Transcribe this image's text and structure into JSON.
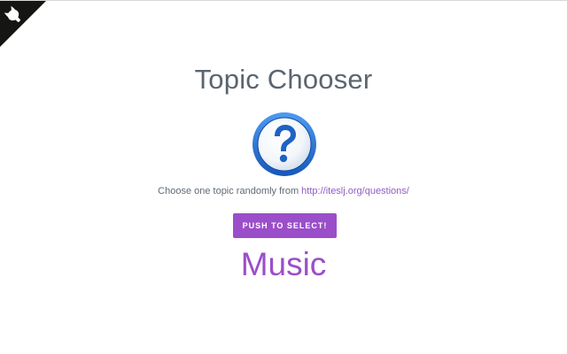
{
  "header": {
    "title": "Topic Chooser"
  },
  "icons": {
    "corner": "github-octocat-icon",
    "center": "question-mark-icon"
  },
  "instructions": {
    "prefix": "Choose one topic randomly from ",
    "link_text": "http://iteslj.org/questions/"
  },
  "action": {
    "button_label": "PUSH TO SELECT!"
  },
  "result": {
    "topic": "Music"
  },
  "colors": {
    "accent": "#9b4ec9",
    "title": "#5b6570",
    "link": "#8e5dc4",
    "icon_blue": "#1f6fd1"
  }
}
